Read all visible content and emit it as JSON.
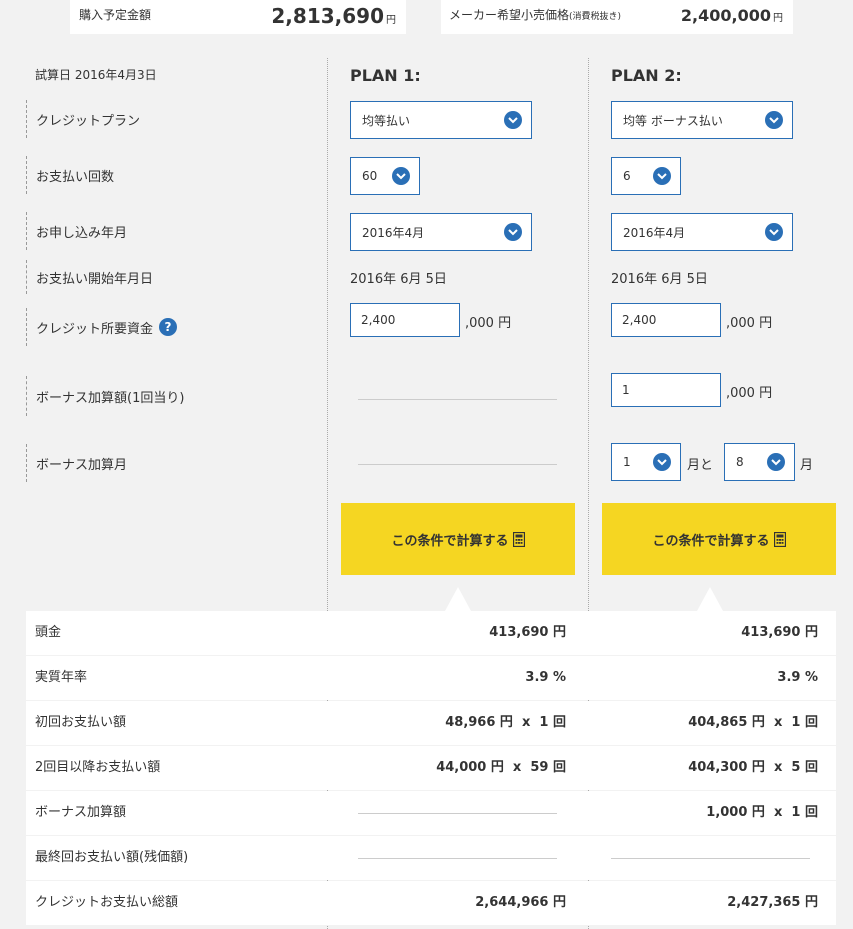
{
  "summary": {
    "purchase_label": "購入予定金額",
    "purchase_value": "2,813,690",
    "purchase_unit": "円",
    "msrp_label": "メーカー希望小売価格",
    "msrp_label_note": "(消費税抜き)",
    "msrp_value": "2,400,000",
    "msrp_unit": "円"
  },
  "trial_date": "試算日 2016年4月3日",
  "labels": {
    "credit_plan": "クレジットプラン",
    "installments": "お支払い回数",
    "application_month": "お申し込み年月",
    "start_date": "お支払い開始年月日",
    "required_funds": "クレジット所要資金",
    "bonus_amount": "ボーナス加算額(1回当り)",
    "bonus_month": "ボーナス加算月",
    "help": "?"
  },
  "unit_thousand_yen": ",000 円",
  "plan1": {
    "title": "PLAN 1:",
    "credit_plan": "均等払い",
    "installments": "60",
    "application_month": "2016年4月",
    "start_date": "2016年 6月 5日",
    "required_funds": "2,400",
    "calc_button": "この条件で計算する"
  },
  "plan2": {
    "title": "PLAN 2:",
    "credit_plan": "均等 ボーナス払い",
    "installments": "6",
    "application_month": "2016年4月",
    "start_date": "2016年 6月 5日",
    "required_funds": "2,400",
    "bonus_amount": "1",
    "bonus_month_1": "1",
    "bonus_month_join": "月と",
    "bonus_month_2": "8",
    "bonus_month_suffix": "月",
    "calc_button": "この条件で計算する"
  },
  "results": [
    {
      "label": "頭金",
      "plan1": "413,690 円",
      "plan2": "413,690 円"
    },
    {
      "label": "実質年率",
      "plan1": "3.9 %",
      "plan2": "3.9 %"
    },
    {
      "label": "初回お支払い額",
      "plan1": "48,966 円  x  1 回",
      "plan2": "404,865 円  x  1 回"
    },
    {
      "label": "2回目以降お支払い額",
      "plan1": "44,000 円  x  59 回",
      "plan2": "404,300 円  x  5 回"
    },
    {
      "label": "ボーナス加算額",
      "plan1": "",
      "plan2": "1,000 円  x  1 回"
    },
    {
      "label": "最終回お支払い額(残価額)",
      "plan1": "",
      "plan2": ""
    },
    {
      "label": "クレジットお支払い総額",
      "plan1": "2,644,966 円",
      "plan2": "2,427,365 円"
    }
  ],
  "colors": {
    "accent": "#2a6fb6",
    "button": "#f5d622",
    "background": "#f2f2f2"
  },
  "icons": {
    "select": "chevron-down-icon",
    "calculate": "calculator-icon",
    "help": "help-icon"
  }
}
